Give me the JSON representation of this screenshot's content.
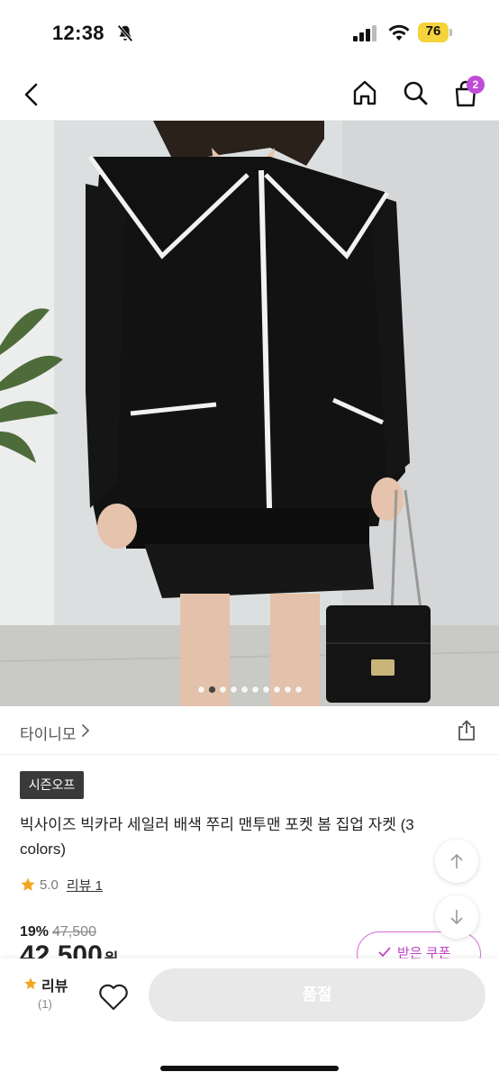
{
  "status_bar": {
    "time": "12:38",
    "battery": "76",
    "icons": [
      "bell-slash-icon",
      "signal-icon",
      "wifi-icon",
      "battery-icon"
    ]
  },
  "header": {
    "icons": [
      "back-icon",
      "home-icon",
      "search-icon",
      "shopping-bag-icon"
    ],
    "cart_count": "2"
  },
  "gallery": {
    "image_count": 10,
    "active_index": 1
  },
  "brand": {
    "name": "타이니모"
  },
  "product": {
    "tag": "시즌오프",
    "title": "빅사이즈 빅카라 세일러 배색 쭈리 맨투맨 포켓 봄 집업 자켓 (3 colors)",
    "rating": "5.0",
    "review_label": "리뷰 1",
    "discount_rate": "19%",
    "original_price": "47,500",
    "sale_price": "42,500",
    "price_unit": "원",
    "coupon_label": "받은 쿠폰"
  },
  "bottom_bar": {
    "review_label": "리뷰",
    "review_count": "(1)",
    "soldout_label": "품절"
  },
  "colors": {
    "accent": "#c04bd8",
    "star": "#f4a623",
    "soldout_bg": "#e8e8e8"
  }
}
